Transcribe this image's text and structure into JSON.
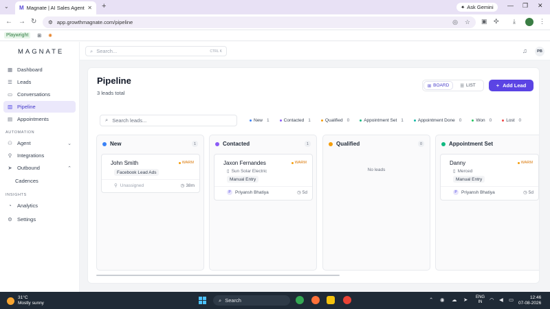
{
  "browser": {
    "tab_title": "Magnate | AI Sales Agent",
    "tab_logo": "M",
    "ask_gemini": "Ask Gemini",
    "url": "app.growthmagnate.com/pipeline",
    "bookmark_playwright": "Playwright"
  },
  "sidebar": {
    "brand": "MAGNATE",
    "items": [
      {
        "label": "Dashboard",
        "icon": "dashboard-icon"
      },
      {
        "label": "Leads",
        "icon": "leads-icon"
      },
      {
        "label": "Conversations",
        "icon": "chat-icon"
      },
      {
        "label": "Pipeline",
        "icon": "pipeline-icon"
      },
      {
        "label": "Appointments",
        "icon": "calendar-icon"
      }
    ],
    "section_automation": "AUTOMATION",
    "automation_items": [
      {
        "label": "Agent",
        "icon": "agent-icon"
      },
      {
        "label": "Integrations",
        "icon": "integrations-icon"
      },
      {
        "label": "Outbound",
        "icon": "outbound-icon"
      },
      {
        "label": "Cadences"
      }
    ],
    "section_insights": "INSIGHTS",
    "insights_items": [
      {
        "label": "Analytics",
        "icon": "analytics-icon"
      },
      {
        "label": "Settings",
        "icon": "settings-icon"
      }
    ]
  },
  "topbar": {
    "search_placeholder": "Search...",
    "shortcut": "CTRL K",
    "user_initials": "PB"
  },
  "page": {
    "title": "Pipeline",
    "subtitle": "3 leads total",
    "view_board": "BOARD",
    "view_list": "LIST",
    "add_lead": "Add Lead",
    "search_placeholder": "Search leads..."
  },
  "filters": [
    {
      "label": "New",
      "count": "1",
      "color": "#3b82f6"
    },
    {
      "label": "Contacted",
      "count": "1",
      "color": "#8b5cf6"
    },
    {
      "label": "Qualified",
      "count": "0",
      "color": "#f59e0b"
    },
    {
      "label": "Appointment Set",
      "count": "1",
      "color": "#10b981"
    },
    {
      "label": "Appointment Done",
      "count": "0",
      "color": "#14b8a6"
    },
    {
      "label": "Won",
      "count": "0",
      "color": "#22c55e"
    },
    {
      "label": "Lost",
      "count": "0",
      "color": "#ef4444"
    }
  ],
  "columns": [
    {
      "title": "New",
      "count": "1",
      "color": "#3b82f6",
      "card": {
        "name": "John Smith",
        "tag": "WARM",
        "source": "Facebook Lead Ads",
        "owner": "Unassigned",
        "age": "38m"
      }
    },
    {
      "title": "Contacted",
      "count": "1",
      "color": "#8b5cf6",
      "card": {
        "name": "Jaxon Fernandes",
        "tag": "WARM",
        "company": "Sun Solar Electric",
        "source": "Manual Entry",
        "owner_initial": "P",
        "owner": "Priyansh Bhatiya",
        "age": "5d"
      }
    },
    {
      "title": "Qualified",
      "count": "0",
      "color": "#f59e0b",
      "empty": "No leads"
    },
    {
      "title": "Appointment Set",
      "count": "1",
      "color": "#10b981",
      "card": {
        "name": "Danny",
        "tag": "WARM",
        "company": "Merced",
        "source": "Manual Entry",
        "owner_initial": "P",
        "owner": "Priyansh Bhatiya",
        "age": "5d"
      }
    }
  ],
  "taskbar": {
    "temp": "31°C",
    "weather": "Mostly sunny",
    "search": "Search",
    "lang1": "ENG",
    "lang2": "IN",
    "time": "12:46",
    "date": "07-08-2026"
  }
}
